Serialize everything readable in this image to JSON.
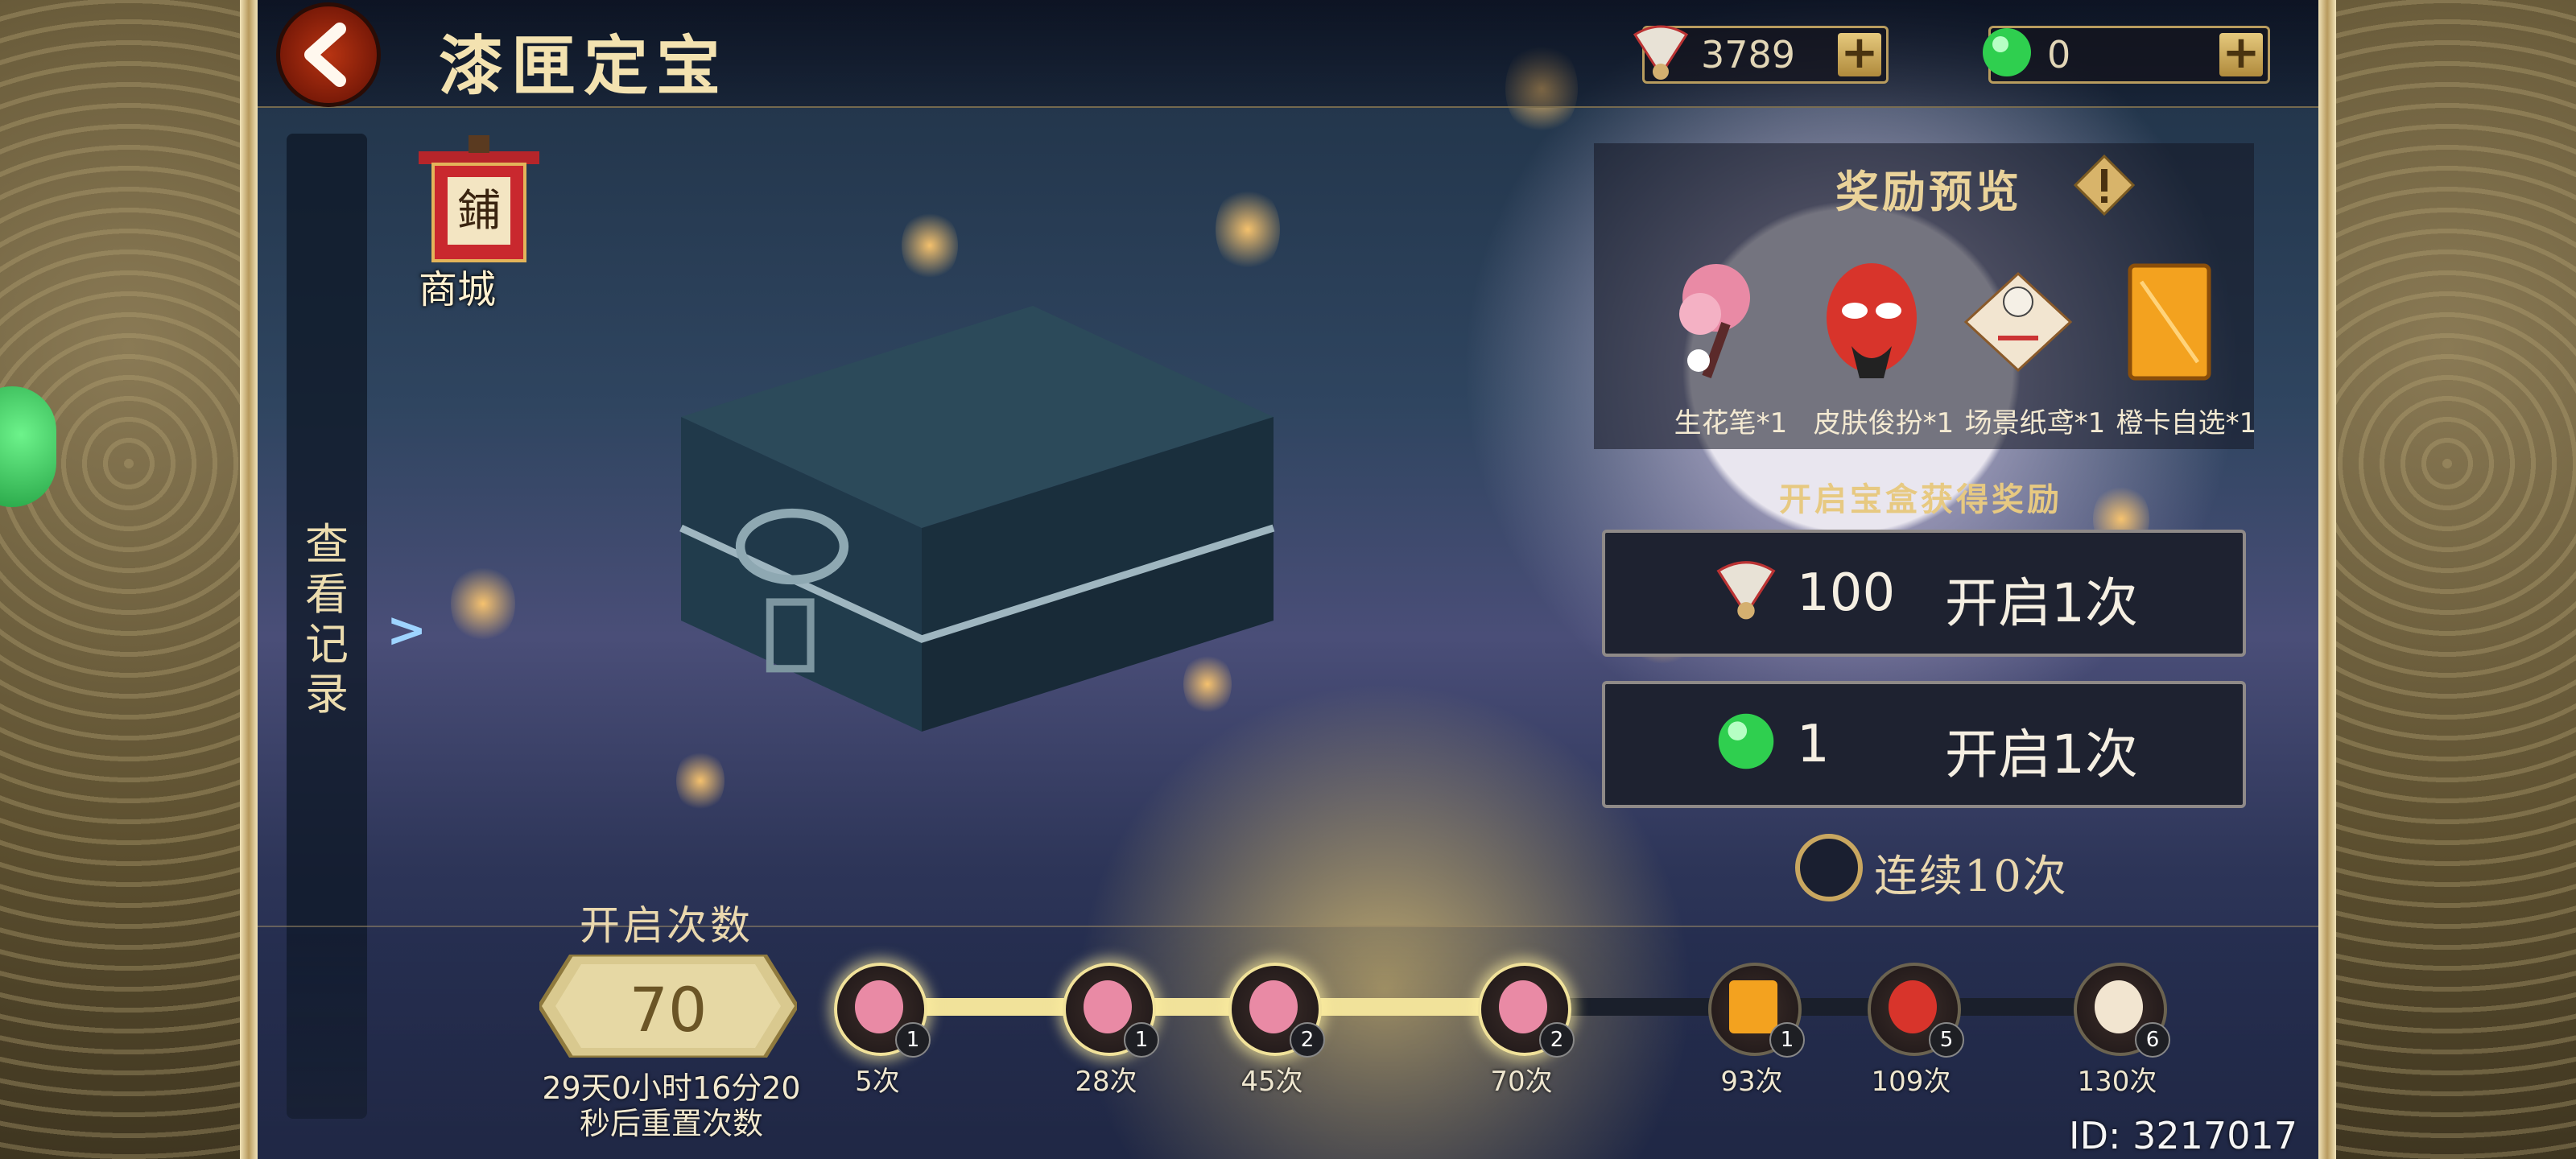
{
  "header": {
    "title": "漆匣定宝",
    "currencies": [
      {
        "icon": "feather-fan-icon",
        "value": "3789"
      },
      {
        "icon": "green-jade-icon",
        "value": "0"
      }
    ]
  },
  "side_nav": {
    "record_label": "查看记录",
    "shop_label": "商城",
    "shop_sign": "鋪"
  },
  "rewards_preview": {
    "title": "奖励预览",
    "items": [
      {
        "icon": "flower-brush-icon",
        "label": "生花笔*1"
      },
      {
        "icon": "opera-mask-icon",
        "label": "皮肤俊扮*1"
      },
      {
        "icon": "paper-kite-icon",
        "label": "场景纸鸢*1"
      },
      {
        "icon": "orange-card-icon",
        "label": "橙卡自选*1"
      }
    ],
    "open_label": "开启宝盒获得奖励"
  },
  "open_buttons": [
    {
      "icon": "feather-fan-icon",
      "price": "100",
      "label": "开启1次"
    },
    {
      "icon": "green-jade-icon",
      "price": "1",
      "label": "开启1次"
    }
  ],
  "continuous": {
    "label": "连续10次",
    "checked": false
  },
  "progress": {
    "title": "开启次数",
    "count": "70",
    "reset_text": "29天0小时16分20秒后重置次数",
    "current": 70,
    "milestones": [
      {
        "label": "5次",
        "count": "1",
        "icon": "flower-brush-icon",
        "done": true
      },
      {
        "label": "28次",
        "count": "1",
        "icon": "flower-brush-icon",
        "done": true
      },
      {
        "label": "45次",
        "count": "2",
        "icon": "flower-brush-icon",
        "done": true
      },
      {
        "label": "70次",
        "count": "2",
        "icon": "flower-brush-icon",
        "done": true
      },
      {
        "label": "93次",
        "count": "1",
        "icon": "orange-card-icon",
        "done": false
      },
      {
        "label": "109次",
        "count": "5",
        "icon": "opera-mask-icon",
        "done": false
      },
      {
        "label": "130次",
        "count": "6",
        "icon": "paper-kite-icon",
        "done": false
      }
    ]
  },
  "footer": {
    "uid": "ID: 3217017"
  },
  "colors": {
    "accent_gold": "#ead39a",
    "button_bg": "#1e2230",
    "progress_fill": "#f1e29a"
  }
}
